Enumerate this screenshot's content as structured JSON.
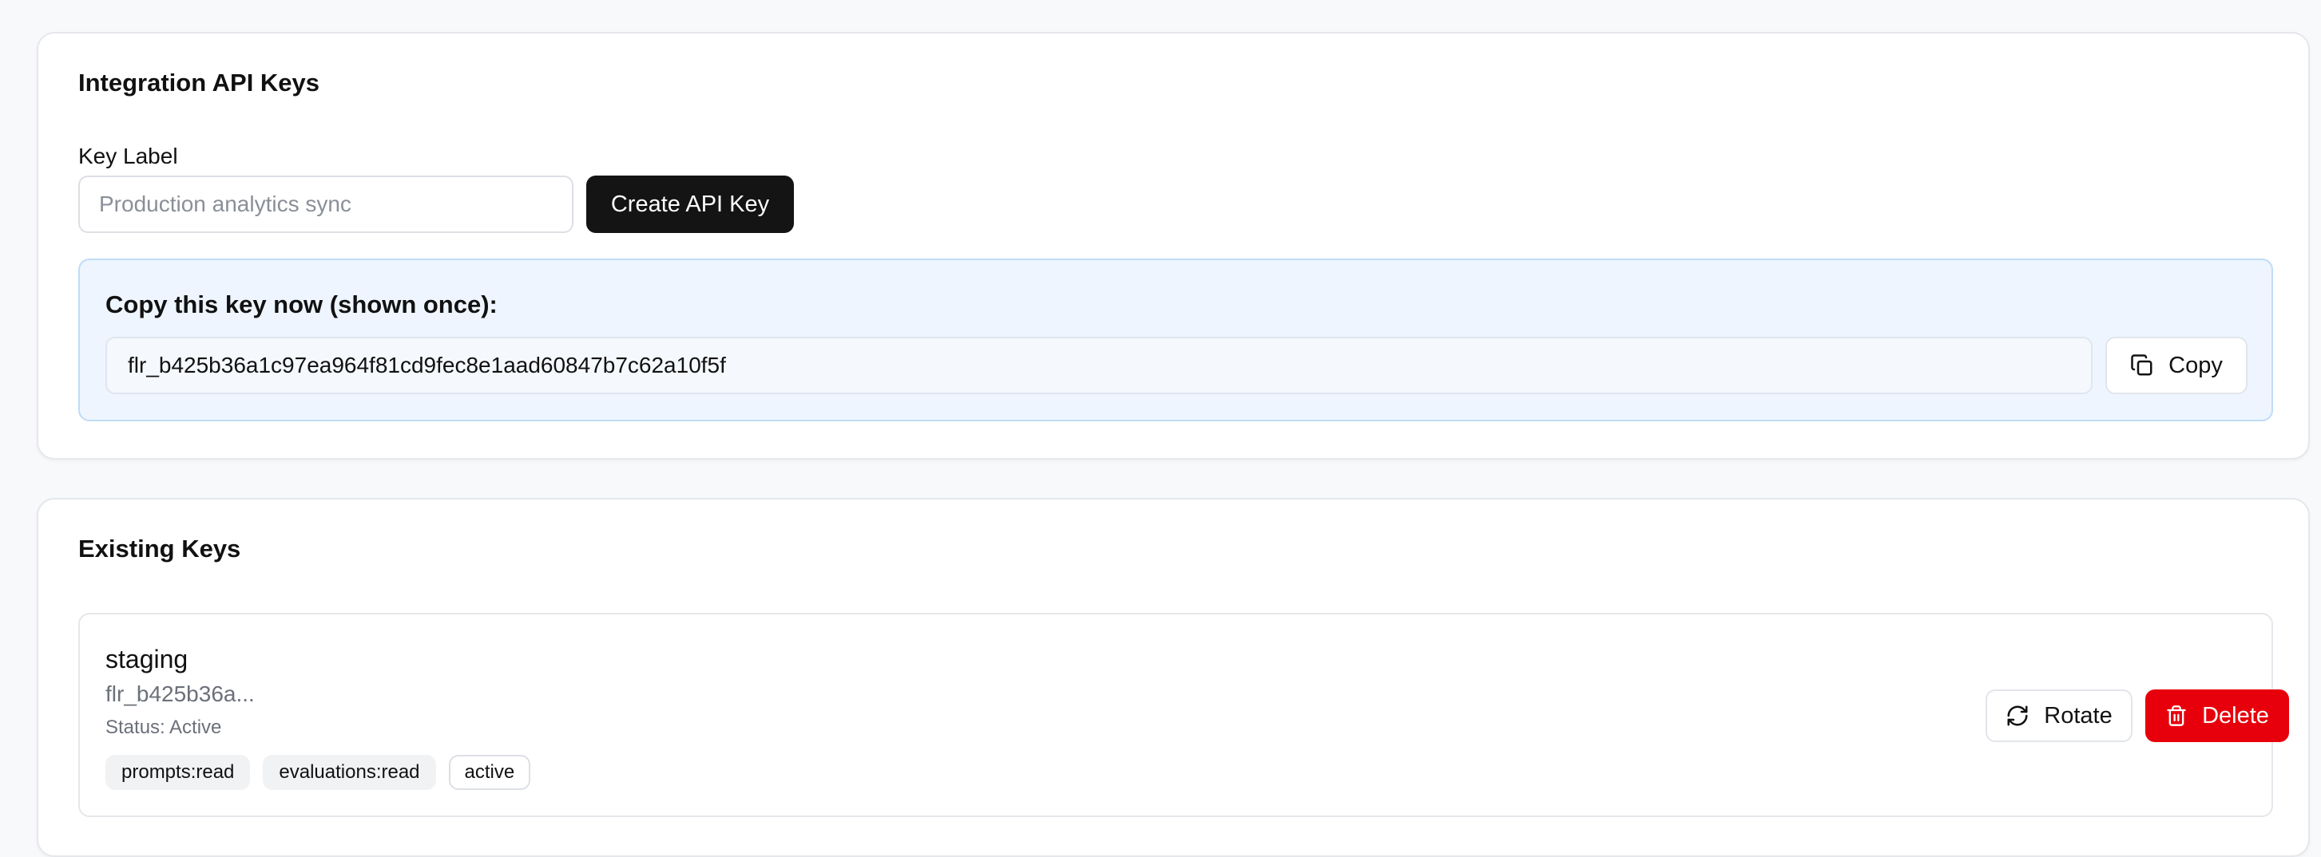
{
  "create_section": {
    "title": "Integration API Keys",
    "label_field": {
      "label": "Key Label",
      "placeholder": "Production analytics sync",
      "value": ""
    },
    "create_button": "Create API Key",
    "new_key": {
      "title": "Copy this key now (shown once):",
      "value": "flr_b425b36a1c97ea964f81cd9fec8e1aad60847b7c62a10f5f",
      "copy_button": "Copy",
      "copy_icon": "copy-icon"
    }
  },
  "existing_section": {
    "title": "Existing Keys",
    "keys": [
      {
        "name": "staging",
        "prefix": "flr_b425b36a...",
        "status": "Status: Active",
        "tags": [
          "prompts:read",
          "evaluations:read",
          "active"
        ],
        "rotate_button": "Rotate",
        "rotate_icon": "refresh-icon",
        "delete_button": "Delete",
        "delete_icon": "trash-icon"
      }
    ]
  },
  "colors": {
    "page_bg": "#f8f9fb",
    "primary_dark": "#141414",
    "info_bg": "#eef5fe",
    "info_border": "#bfdcf7",
    "danger": "#e7000b"
  }
}
